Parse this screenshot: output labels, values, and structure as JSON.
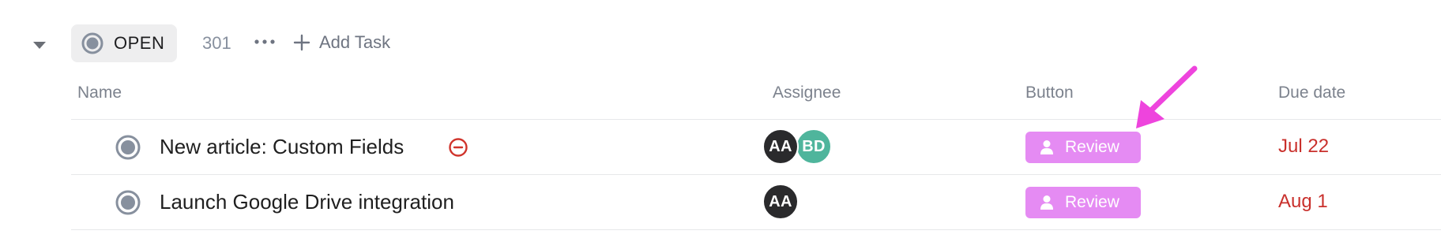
{
  "group": {
    "status_label": "OPEN",
    "status_color": "#87909e",
    "task_count": "301",
    "more_icon": "ellipsis-icon",
    "add_task_label": "Add Task"
  },
  "columns": {
    "name": "Name",
    "assignee": "Assignee",
    "button": "Button",
    "due_date": "Due date"
  },
  "tasks": [
    {
      "name": "New article: Custom Fields",
      "blocked_icon": "blocked-icon",
      "assignees": [
        {
          "initials": "AA",
          "color": "#2a2a2c"
        },
        {
          "initials": "BD",
          "color": "#4fb59c"
        }
      ],
      "button_label": "Review",
      "button_color": "#e58bf3",
      "due_date": "Jul 22",
      "due_color": "#c9302c"
    },
    {
      "name": "Launch Google Drive integration",
      "assignees": [
        {
          "initials": "AA",
          "color": "#2a2a2c"
        }
      ],
      "button_label": "Review",
      "button_color": "#e58bf3",
      "due_date": "Aug 1",
      "due_color": "#c9302c"
    }
  ],
  "annotation": {
    "arrow_color": "#ee44dd"
  }
}
